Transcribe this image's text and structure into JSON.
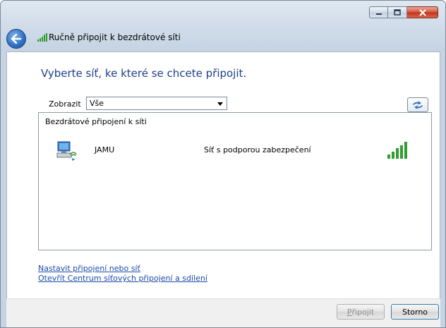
{
  "window": {
    "title": "Ručně připojit k bezdrátové síti",
    "controls": {
      "minimize": "minimize-icon",
      "maximize": "maximize-icon",
      "close": "close-icon"
    }
  },
  "heading": "Vyberte síť, ke které se chcete připojit.",
  "filter": {
    "label": "Zobrazit",
    "selected": "Vše"
  },
  "list": {
    "group": "Bezdrátové připojení k síti",
    "networks": [
      {
        "name": "JAMU",
        "security": "Síť s podporou zabezpečení",
        "icon": "wireless-network-icon",
        "signal_bars": 5
      }
    ]
  },
  "links": {
    "setup": "Nastavit připojení nebo síť",
    "center": "Otevřít Centrum síťových připojení a sdílení"
  },
  "buttons": {
    "connect_first": "P",
    "connect_rest": "řipojit",
    "cancel": "Storno"
  },
  "colors": {
    "heading": "#1e3e8a",
    "link": "#1a4bab",
    "signal": "#2f9d2f"
  }
}
